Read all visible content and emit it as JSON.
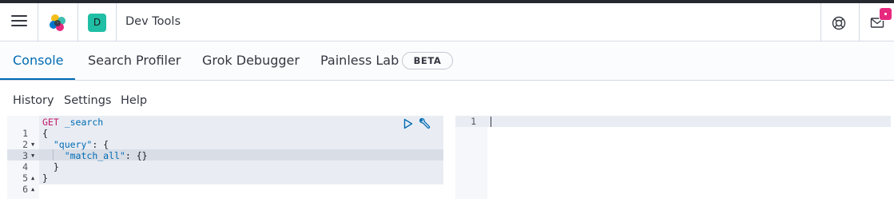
{
  "header": {
    "space_initial": "D",
    "app_title": "Dev Tools",
    "icons": [
      "menu-icon",
      "kibana-logo",
      "help-icon",
      "mail-icon"
    ]
  },
  "tabs": {
    "items": [
      {
        "label": "Console",
        "active": true
      },
      {
        "label": "Search Profiler",
        "active": false
      },
      {
        "label": "Grok Debugger",
        "active": false
      },
      {
        "label": "Painless Lab",
        "active": false
      }
    ],
    "beta_label": "BETA"
  },
  "subnav": {
    "history": "History",
    "settings": "Settings",
    "help": "Help"
  },
  "editor": {
    "line_numbers": [
      "1",
      "2",
      "3",
      "4",
      "5",
      "6"
    ],
    "method": "GET",
    "path": " _search",
    "line2": "{",
    "query_key": "\"query\"",
    "query_rest": ": {",
    "match_key": "\"match_all\"",
    "match_rest": ": {}",
    "line5": "  }",
    "line6": "}"
  },
  "output": {
    "line_number": "1"
  },
  "colors": {
    "accent": "#006bb4",
    "space_avatar": "#20bfa5",
    "notification_badge": "#e7287f",
    "method_color": "#c41a6b"
  }
}
